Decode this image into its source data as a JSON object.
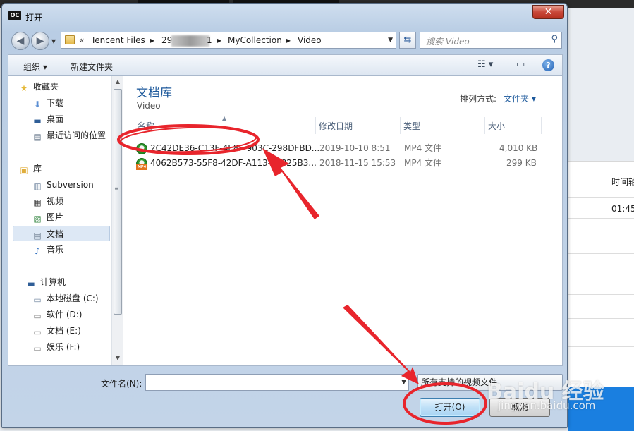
{
  "window": {
    "title": "打开",
    "app_icon_text": "OC",
    "close_symbol": "✕"
  },
  "address": {
    "segments": [
      "«",
      "Tencent Files",
      "29",
      "1",
      "MyCollection",
      "Video"
    ],
    "separator": "▸"
  },
  "search": {
    "placeholder": "搜索 Video"
  },
  "toolbar": {
    "organize": "组织 ▾",
    "new_folder": "新建文件夹",
    "help": "?"
  },
  "sidebar": {
    "favorites_header": "收藏夹",
    "favorites": [
      "下载",
      "桌面",
      "最近访问的位置"
    ],
    "libraries_header": "库",
    "libraries": [
      "Subversion",
      "视频",
      "图片",
      "文档",
      "音乐"
    ],
    "selected": "文档",
    "computer_header": "计算机",
    "drives": [
      "本地磁盘 (C:)",
      "软件 (D:)",
      "文档 (E:)",
      "娱乐 (F:)"
    ]
  },
  "content": {
    "library_title": "文档库",
    "library_subtitle": "Video",
    "sort_label": "排列方式:",
    "sort_value": "文件夹 ▾",
    "columns": [
      "名称",
      "修改日期",
      "类型",
      "大小"
    ],
    "files": [
      {
        "name": "2C42DE36-C13F-4E8F-903C-298DFBD...",
        "date": "2019-10-10 8:51",
        "type": "MP4 文件",
        "size": "4,010 KB"
      },
      {
        "name": "4062B573-55F8-42DF-A113-3F825B3...",
        "date": "2018-11-15 15:53",
        "type": "MP4 文件",
        "size": "299 KB"
      }
    ]
  },
  "bottom": {
    "filename_label": "文件名(N):",
    "filename_value": "",
    "filter": "所有支持的视频文件",
    "open_button": "打开(O)",
    "cancel_button": "取消"
  },
  "background": {
    "column_header": "时间轴",
    "time": "01:45"
  },
  "watermark": {
    "main": "Baidu 经验",
    "sub": "jingyan.baidu.com"
  },
  "colors": {
    "annotation_red": "#e8252c",
    "library_title_blue": "#1e5a9c"
  }
}
